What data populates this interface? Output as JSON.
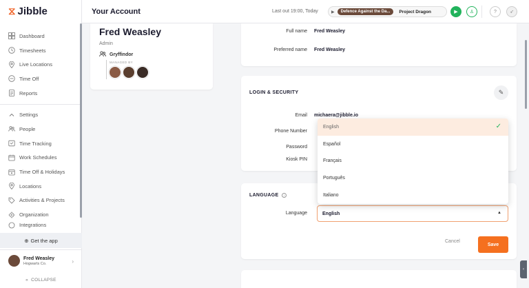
{
  "app": {
    "name": "Jibble"
  },
  "sidebar": {
    "items": [
      {
        "label": "Dashboard",
        "icon": "dashboard-icon"
      },
      {
        "label": "Timesheets",
        "icon": "clock-icon"
      },
      {
        "label": "Live Locations",
        "icon": "location-pin-icon"
      },
      {
        "label": "Time Off",
        "icon": "time-off-icon"
      },
      {
        "label": "Reports",
        "icon": "reports-icon"
      }
    ],
    "settings_items": [
      {
        "label": "Settings",
        "icon": "chevron-up-icon"
      },
      {
        "label": "People",
        "icon": "people-icon"
      },
      {
        "label": "Time Tracking",
        "icon": "time-tracking-icon"
      },
      {
        "label": "Work Schedules",
        "icon": "schedule-icon"
      },
      {
        "label": "Time Off & Holidays",
        "icon": "holidays-icon"
      },
      {
        "label": "Locations",
        "icon": "location-pin-icon"
      },
      {
        "label": "Activities & Projects",
        "icon": "tag-icon"
      },
      {
        "label": "Organization",
        "icon": "organization-icon"
      },
      {
        "label": "Integrations",
        "icon": "integrations-icon"
      }
    ],
    "get_app": "Get the app",
    "user": {
      "name": "Fred Weasley",
      "org": "Hogwarts Co."
    },
    "collapse": "COLLAPSE"
  },
  "header": {
    "title": "Your Account",
    "last_out": "Last out 19:00, Today",
    "activity": "Defence Against the Da...",
    "project": "Project Dragon"
  },
  "profile": {
    "name": "Fred Weasley",
    "role": "Admin",
    "group": "Gryffindor",
    "managed_by": "MANAGED BY"
  },
  "names": {
    "full_name_label": "Full name",
    "full_name": "Fred Weasley",
    "preferred_name_label": "Preferred name",
    "preferred_name": "Fred Weasley"
  },
  "login": {
    "title": "LOGIN & SECURITY",
    "email_label": "Email",
    "email": "michaera@jibble.io",
    "phone_label": "Phone Number",
    "password_label": "Password",
    "kiosk_label": "Kiosk PIN"
  },
  "language": {
    "title": "LANGUAGE",
    "label": "Language",
    "selected": "English",
    "options": [
      "English",
      "Español",
      "Français",
      "Português",
      "Italiano"
    ],
    "cancel": "Cancel",
    "save": "Save"
  },
  "colors": {
    "accent": "#f5701f",
    "brand": "#f0652a",
    "play": "#22b35c",
    "activity_pill": "#6b4a3a"
  }
}
